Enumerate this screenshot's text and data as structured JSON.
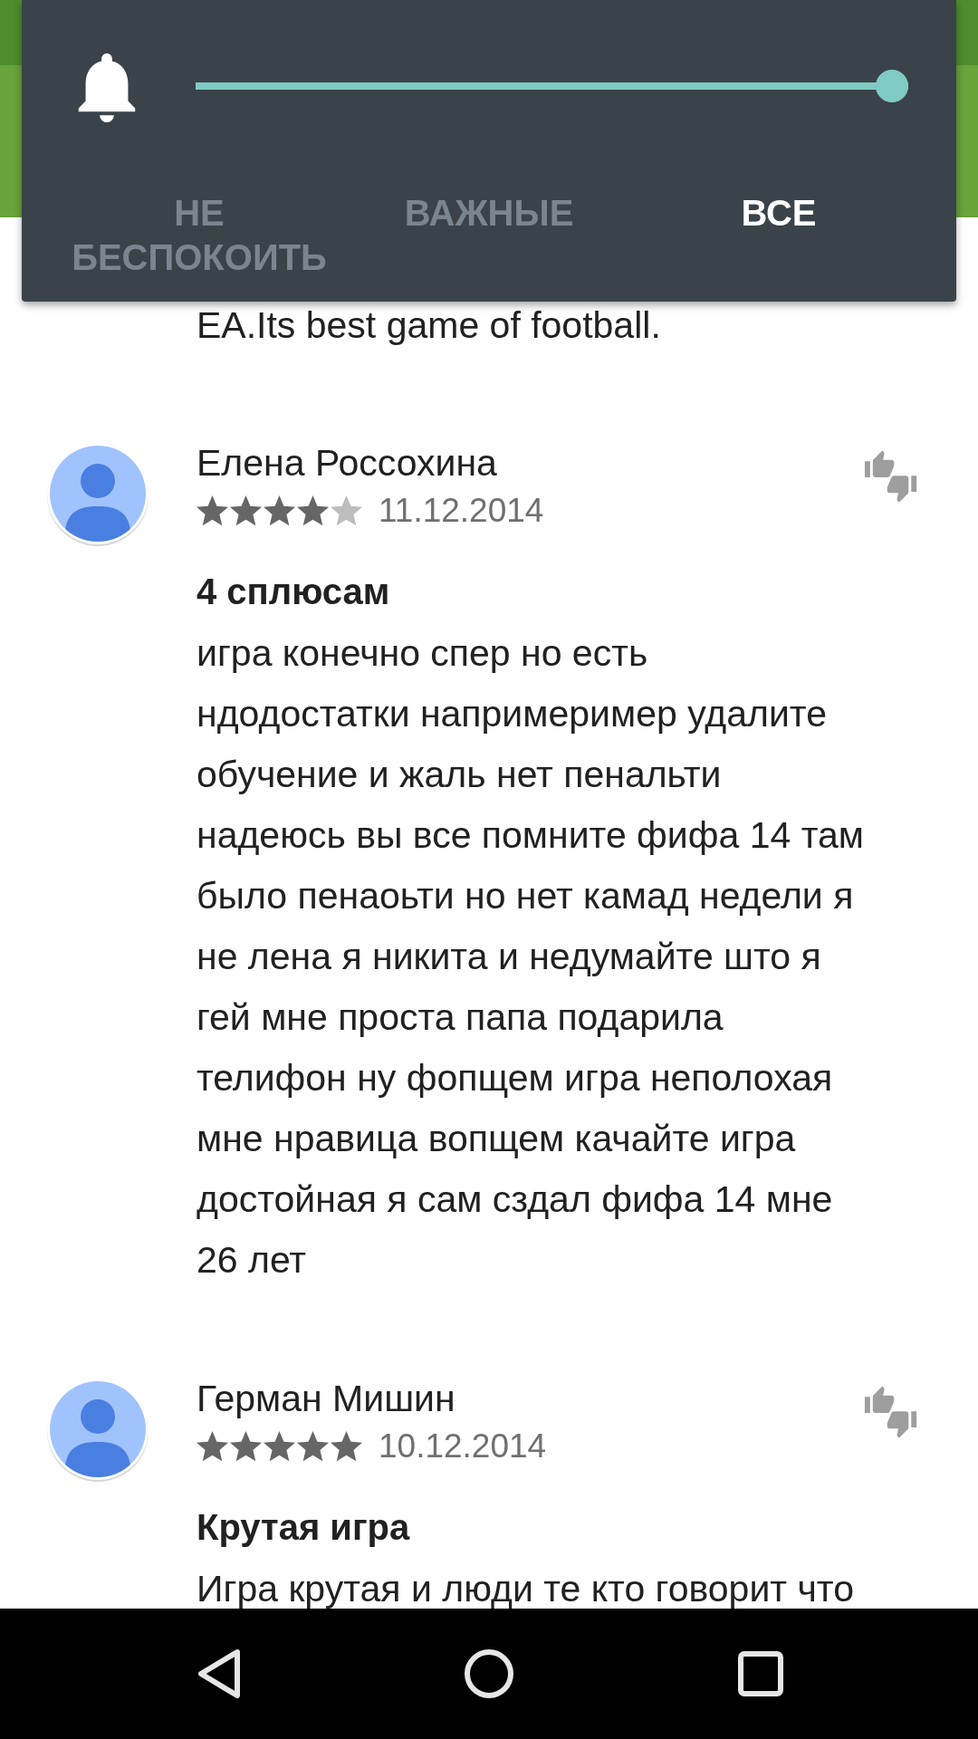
{
  "volume_panel": {
    "slider": {
      "level": 1
    },
    "tabs": [
      {
        "label": "НЕ БЕСПОКОИТЬ",
        "selected": false
      },
      {
        "label": "ВАЖНЫЕ",
        "selected": false
      },
      {
        "label": "ВСЕ",
        "selected": true
      }
    ]
  },
  "previous_review_end": "EA.Its best game of football.",
  "reviews": [
    {
      "author": "Елена Россохина",
      "stars": 4,
      "date": "11.12.2014",
      "title": "4 сплюсам",
      "body": "игра конечно спер но есть\nндодостатки напримеример удалите\nобучение и жаль нет пенальти\nнадеюсь вы все помните фифа 14 там\nбыло пенаоьти но нет камад недели я\nне лена я никита и недумайте што я\nгей мне проста папа подарила\nтелифон ну фопщем игра неполохая\nмне нравица вопщем качайте игра\nдостойная я сам сздал фифа 14 мне\n26 лет"
    },
    {
      "author": "Герман Мишин",
      "stars": 5,
      "date": "10.12.2014",
      "title": "Крутая игра",
      "body": "Игра крутая и люди те кто говорит что"
    }
  ]
}
